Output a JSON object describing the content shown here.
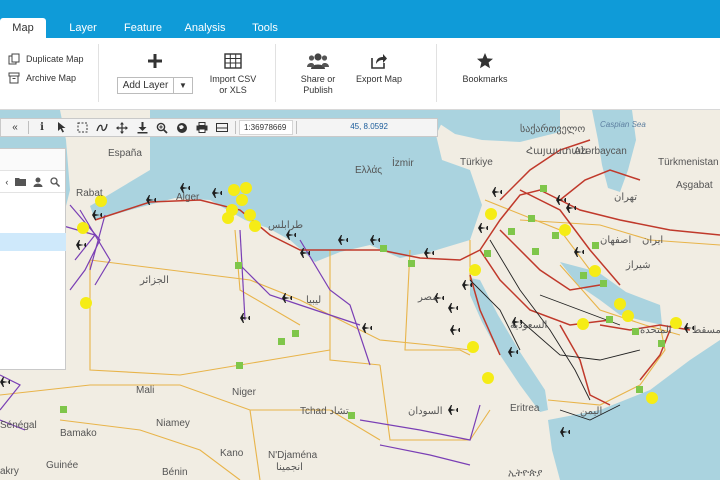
{
  "tabs": [
    {
      "label": "Map",
      "active": true
    },
    {
      "label": "Layer",
      "active": false
    },
    {
      "label": "Feature",
      "active": false
    },
    {
      "label": "Analysis",
      "active": false
    },
    {
      "label": "Tools",
      "active": false
    }
  ],
  "ribbon": {
    "duplicate_map": "Duplicate Map",
    "archive_map": "Archive Map",
    "add_layer": "Add Layer",
    "import_csv_line1": "Import CSV",
    "import_csv_line2": "or XLS",
    "share_line1": "Share or",
    "share_line2": "Publish",
    "export_map": "Export Map",
    "bookmarks": "Bookmarks"
  },
  "map_toolbar": {
    "scale": "1:36978669",
    "coordinates": "45, 8.0592"
  },
  "map_labels": {
    "espana": "España",
    "ellas": "Ελλάς",
    "izmir": "İzmir",
    "turkiye": "Türkiye",
    "georgia": "საქართველო",
    "armenia": "Հայաստան",
    "azerbaycan": "Azərbaycan",
    "caspian": "Caspian Sea",
    "turkmenistan": "Türkmenistan",
    "asgabat": "Aşgabat",
    "tehran": "تهران",
    "esfahan": "اصفهان",
    "iran": "ایران",
    "shiraz": "شیراز",
    "rabat": "Rabat",
    "alger": "Alger",
    "tripoli": "طرابلس",
    "algeria": "الجزائر",
    "libya": "ليبيا",
    "egypt": "مصر",
    "saudi": "السعودية",
    "sudan": "السودان",
    "yemen": "اليمن",
    "eritrea": "Eritrea",
    "tchad": "Tchad تشاد",
    "mali": "Mali",
    "niger": "Niger",
    "niamey": "Niamey",
    "bamako": "Bamako",
    "senegal": "Sénégal",
    "guinee": "Guinée",
    "benin": "Bénin",
    "kano": "Kano",
    "ndjamena": "N'Djaména",
    "ndjamena_ar": "انجمينا",
    "uae": "المتحدة",
    "muscat": "مسقط",
    "dakar": "akry",
    "ethiopia": "ኢትዮጵያ"
  },
  "colors": {
    "tab_bar": "#0f9bd8",
    "water": "#aad3df",
    "land": "#f1ede3",
    "rail": "#c0392b",
    "power": "#7a3fb5",
    "border": "#e8b44a",
    "marker_yellow": "#f5ec16",
    "marker_green": "#7fc64a",
    "airport": "#1e1e1e"
  }
}
